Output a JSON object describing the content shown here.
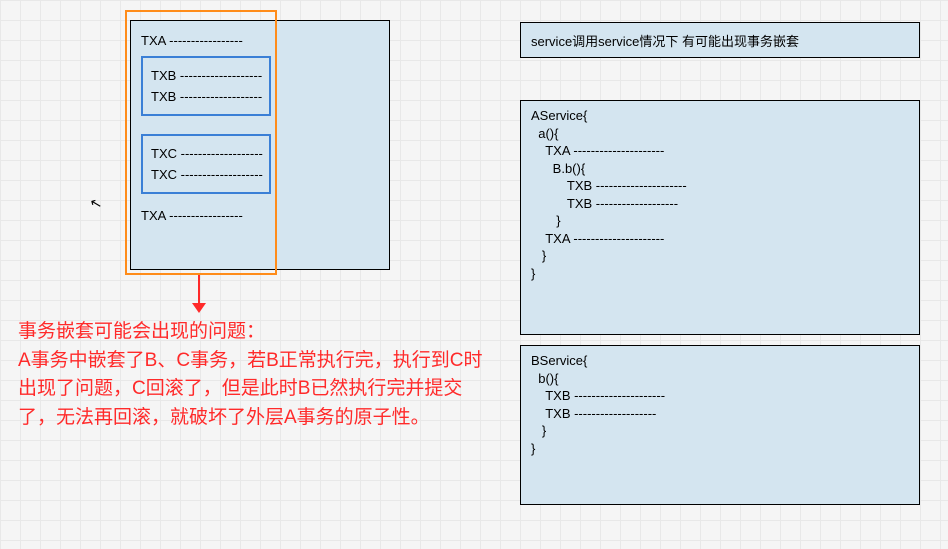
{
  "left": {
    "txa_start": "TXA -----------------",
    "txb_1": "TXB -------------------",
    "txb_2": "TXB -------------------",
    "txc_1": "TXC -------------------",
    "txc_2": "TXC -------------------",
    "txa_end": "TXA -----------------"
  },
  "explanation": {
    "title": "事务嵌套可能会出现的问题：",
    "body": "A事务中嵌套了B、C事务，若B正常执行完，执行到C时出现了问题，C回滚了，但是此时B已然执行完并提交了，无法再回滚，就破坏了外层A事务的原子性。"
  },
  "topright": {
    "text": "service调用service情况下 有可能出现事务嵌套"
  },
  "aservice": {
    "l1": "AService{",
    "l2": "",
    "l3": "  a(){",
    "l4": "    TXA ---------------------",
    "l5": "      B.b(){",
    "l6": "          TXB ---------------------",
    "l7": "",
    "l8": "          TXB -------------------",
    "l9": "       }",
    "l10": "",
    "l11": "    TXA ---------------------",
    "l12": "   }",
    "l13": "}"
  },
  "bservice": {
    "l1": "BService{",
    "l2": "",
    "l3": "  b(){",
    "l4": "    TXB ---------------------",
    "l5": "",
    "l6": "",
    "l7": "    TXB -------------------",
    "l8": "   }",
    "l9": "}"
  }
}
